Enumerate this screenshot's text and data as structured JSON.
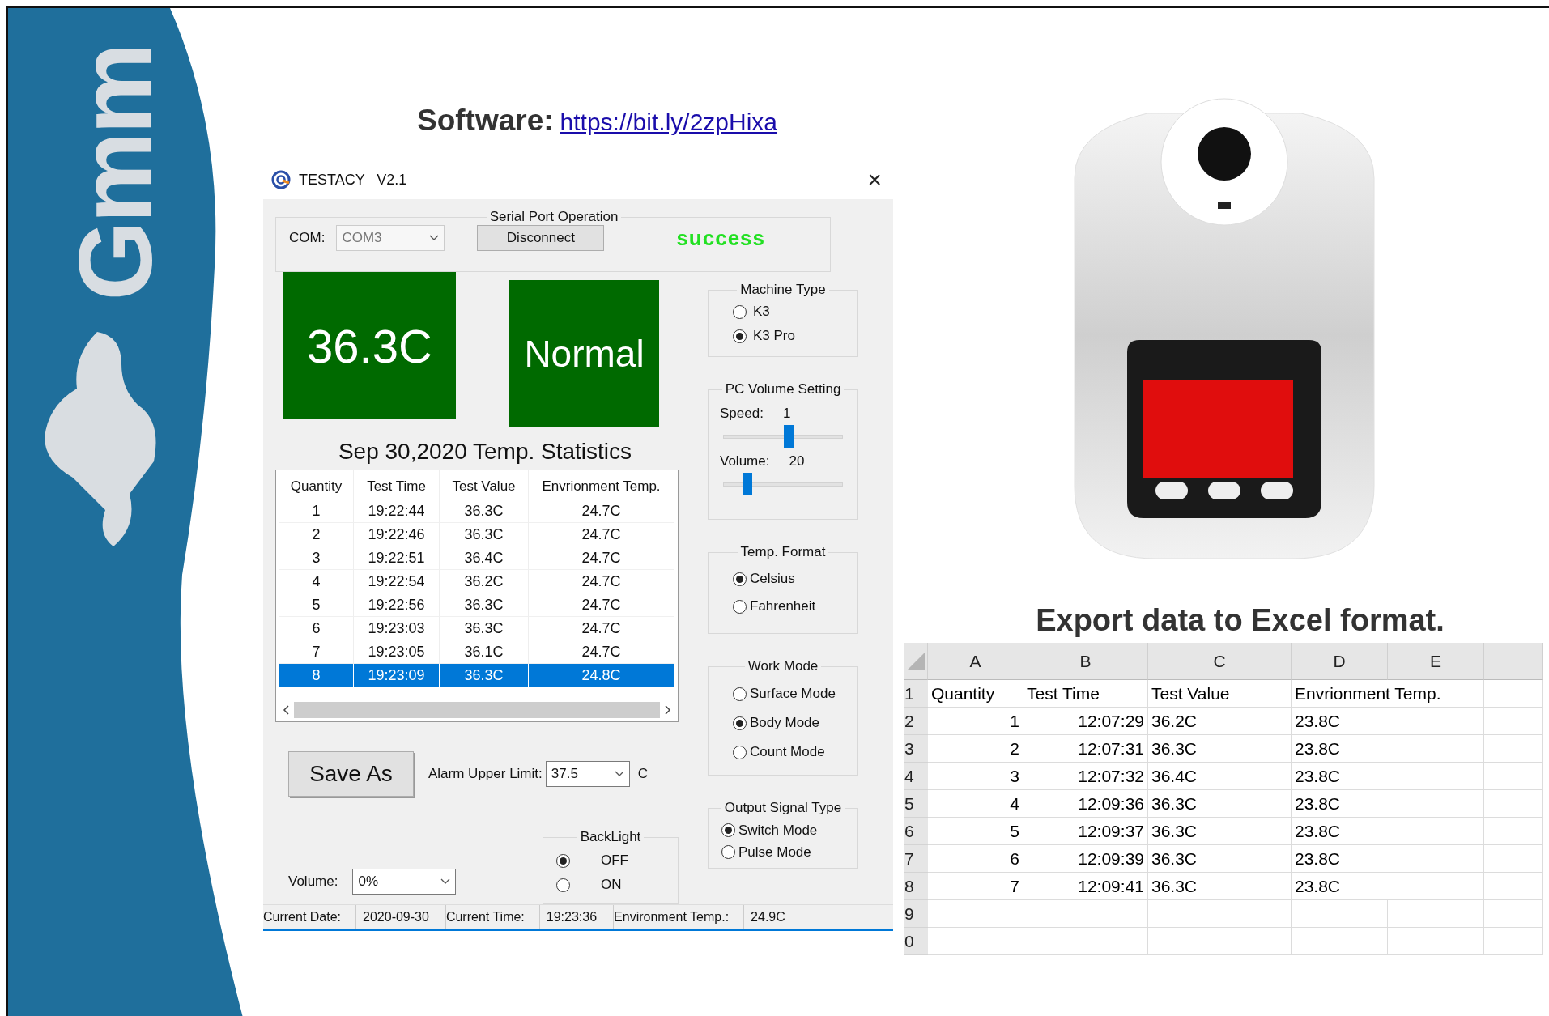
{
  "logo": {
    "text": "Gmm"
  },
  "heading": {
    "label": "Software:",
    "link": "https://bit.ly/2zpHixa"
  },
  "app_window": {
    "title": "TESTACY   V2.1",
    "close": "×",
    "serial_port": {
      "legend": "Serial Port Operation",
      "com_label": "COM:",
      "com_value": "COM3",
      "button": "Disconnect",
      "status": "success"
    },
    "temperature_display": "36.3C",
    "status_display": "Normal",
    "statistics_title": "Sep 30,2020 Temp. Statistics",
    "table": {
      "columns": [
        "Quantity",
        "Test Time",
        "Test Value",
        "Envrionment Temp."
      ],
      "rows": [
        {
          "cells": [
            "1",
            "19:22:44",
            "36.3C",
            "24.7C"
          ],
          "selected": false
        },
        {
          "cells": [
            "2",
            "19:22:46",
            "36.3C",
            "24.7C"
          ],
          "selected": false
        },
        {
          "cells": [
            "3",
            "19:22:51",
            "36.4C",
            "24.7C"
          ],
          "selected": false
        },
        {
          "cells": [
            "4",
            "19:22:54",
            "36.2C",
            "24.7C"
          ],
          "selected": false
        },
        {
          "cells": [
            "5",
            "19:22:56",
            "36.3C",
            "24.7C"
          ],
          "selected": false
        },
        {
          "cells": [
            "6",
            "19:23:03",
            "36.3C",
            "24.7C"
          ],
          "selected": false
        },
        {
          "cells": [
            "7",
            "19:23:05",
            "36.1C",
            "24.7C"
          ],
          "selected": false
        },
        {
          "cells": [
            "8",
            "19:23:09",
            "36.3C",
            "24.8C"
          ],
          "selected": true
        }
      ]
    },
    "machine_type": {
      "legend": "Machine Type",
      "options": [
        {
          "label": "K3",
          "selected": false
        },
        {
          "label": "K3  Pro",
          "selected": true
        }
      ]
    },
    "pc_volume": {
      "legend": "PC Volume Setting",
      "sliders": [
        {
          "label": "Speed:",
          "value": "1",
          "level": 0.55
        },
        {
          "label": "Volume:",
          "value": "20",
          "level": 0.2
        }
      ]
    },
    "temp_format": {
      "legend": "Temp. Format",
      "options": [
        {
          "label": "Celsius",
          "selected": true
        },
        {
          "label": "Fahrenheit",
          "selected": false
        }
      ]
    },
    "work_mode": {
      "legend": "Work Mode",
      "options": [
        {
          "label": "Surface Mode",
          "selected": false
        },
        {
          "label": "Body Mode",
          "selected": true
        },
        {
          "label": "Count Mode",
          "selected": false
        }
      ]
    },
    "save_button": "Save As",
    "alarm": {
      "label": "Alarm Upper Limit:",
      "value": "37.5",
      "unit": "C"
    },
    "volume": {
      "label": "Volume:",
      "value": "0%"
    },
    "backlight": {
      "legend": "BackLight",
      "options": [
        {
          "label": "OFF",
          "selected": true
        },
        {
          "label": "ON",
          "selected": false
        }
      ]
    },
    "output_signal": {
      "legend": "Output Signal Type",
      "options": [
        {
          "label": "Switch Mode",
          "selected": true
        },
        {
          "label": "Pulse Mode",
          "selected": false
        }
      ]
    },
    "status_bar": [
      {
        "label": "Current Date:",
        "value": "2020-09-30"
      },
      {
        "label": "Current Time:",
        "value": "19:23:36"
      },
      {
        "label": "Environment Temp.:",
        "value": "24.9C"
      }
    ]
  },
  "excel": {
    "title": "Export data to Excel format.",
    "column_headers": [
      "A",
      "B",
      "C",
      "D",
      "E"
    ],
    "rows": [
      {
        "header": "1",
        "cells": [
          "Quantity",
          "Test Time",
          "Test Value",
          "Envrionment Temp.",
          ""
        ]
      },
      {
        "header": "2",
        "cells": [
          "1",
          "12:07:29",
          "36.2C",
          "23.8C",
          ""
        ]
      },
      {
        "header": "3",
        "cells": [
          "2",
          "12:07:31",
          "36.3C",
          "23.8C",
          ""
        ]
      },
      {
        "header": "4",
        "cells": [
          "3",
          "12:07:32",
          "36.4C",
          "23.8C",
          ""
        ]
      },
      {
        "header": "5",
        "cells": [
          "4",
          "12:09:36",
          "36.3C",
          "23.8C",
          ""
        ]
      },
      {
        "header": "6",
        "cells": [
          "5",
          "12:09:37",
          "36.3C",
          "23.8C",
          ""
        ]
      },
      {
        "header": "7",
        "cells": [
          "6",
          "12:09:39",
          "36.3C",
          "23.8C",
          ""
        ]
      },
      {
        "header": "8",
        "cells": [
          "7",
          "12:09:41",
          "36.3C",
          "23.8C",
          ""
        ]
      },
      {
        "header": "9",
        "cells": [
          "",
          "",
          "",
          "",
          ""
        ]
      },
      {
        "header": "0",
        "cells": [
          "",
          "",
          "",
          "",
          ""
        ]
      }
    ]
  }
}
